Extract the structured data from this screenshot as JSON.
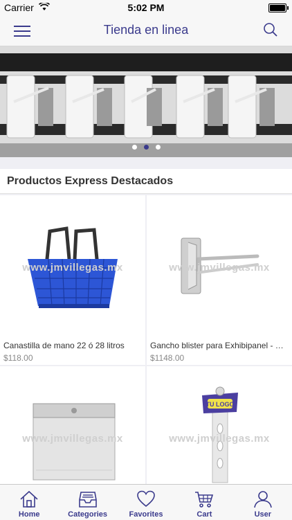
{
  "status": {
    "carrier": "Carrier",
    "time": "5:02 PM"
  },
  "nav": {
    "title": "Tienda en linea"
  },
  "carousel": {
    "dots": 3,
    "active": 1
  },
  "section": {
    "title": "Productos Express Destacados"
  },
  "products": [
    {
      "name": "Canastilla de mano 22 ó 28 litros",
      "price": "$118.00",
      "watermark": "www.jmvillegas.mx"
    },
    {
      "name": "Gancho blister para Exhibipanel - Caja...",
      "price": "$1148.00",
      "watermark": "www.jmvillegas.mx"
    },
    {
      "name": "",
      "price": "",
      "watermark": "www.jmvillegas.mx"
    },
    {
      "name": "",
      "price": "",
      "watermark": "www.jmvillegas.mx"
    }
  ],
  "tabs": [
    {
      "label": "Home",
      "icon": "home-icon"
    },
    {
      "label": "Categories",
      "icon": "tray-icon"
    },
    {
      "label": "Favorites",
      "icon": "heart-icon"
    },
    {
      "label": "Cart",
      "icon": "cart-icon"
    },
    {
      "label": "User",
      "icon": "user-icon"
    }
  ],
  "colors": {
    "accent": "#3a3a8c",
    "basket": "#2d56d6"
  }
}
